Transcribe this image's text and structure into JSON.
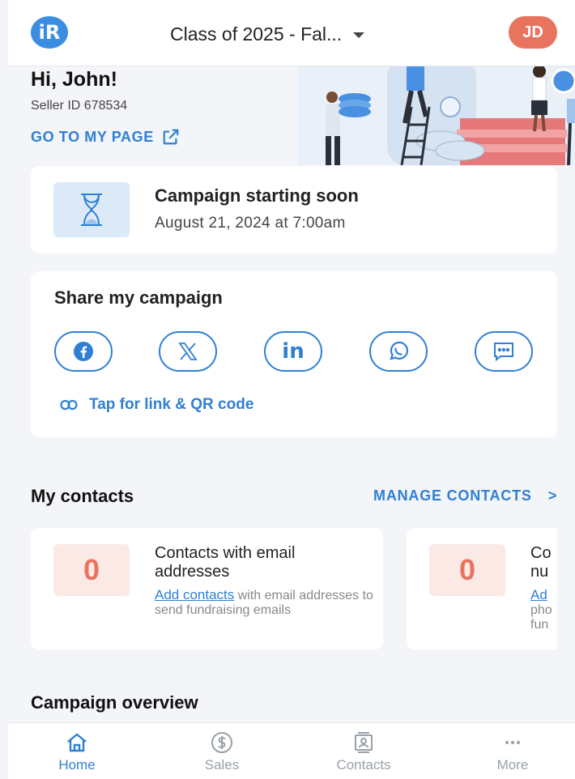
{
  "header": {
    "logo_text": "iR",
    "class_selector": "Class of 2025 - Fal...",
    "avatar_initials": "JD"
  },
  "greeting": {
    "hi": "Hi, John!",
    "seller_id": "Seller ID 678534",
    "goto_link": "GO TO MY PAGE"
  },
  "campaign": {
    "title": "Campaign starting soon",
    "date": "August 21, 2024 at 7:00am"
  },
  "share": {
    "title": "Share my campaign",
    "buttons": [
      {
        "icon": "facebook-icon"
      },
      {
        "icon": "x-icon"
      },
      {
        "icon": "linkedin-icon",
        "text": "in"
      },
      {
        "icon": "whatsapp-icon"
      },
      {
        "icon": "message-icon"
      }
    ],
    "link_text": "Tap for link & QR code"
  },
  "contacts": {
    "title": "My contacts",
    "manage": "MANAGE CONTACTS",
    "chevron": ">",
    "cards": [
      {
        "count": "0",
        "title": "Contacts with email addresses",
        "link": "Add contacts",
        "desc": " with email addresses to send fundraising emails"
      },
      {
        "count": "0",
        "title": "Co nu",
        "link": "Ad",
        "desc": "pho fun"
      }
    ]
  },
  "overview": {
    "title": "Campaign overview"
  },
  "nav": {
    "items": [
      {
        "label": "Home",
        "icon": "home-icon",
        "active": true
      },
      {
        "label": "Sales",
        "icon": "dollar-icon"
      },
      {
        "label": "Contacts",
        "icon": "contacts-icon"
      },
      {
        "label": "More",
        "icon": "more-icon"
      }
    ]
  },
  "colors": {
    "accent": "#2f80d4",
    "avatar": "#e8735e",
    "count": "#e8735e"
  }
}
